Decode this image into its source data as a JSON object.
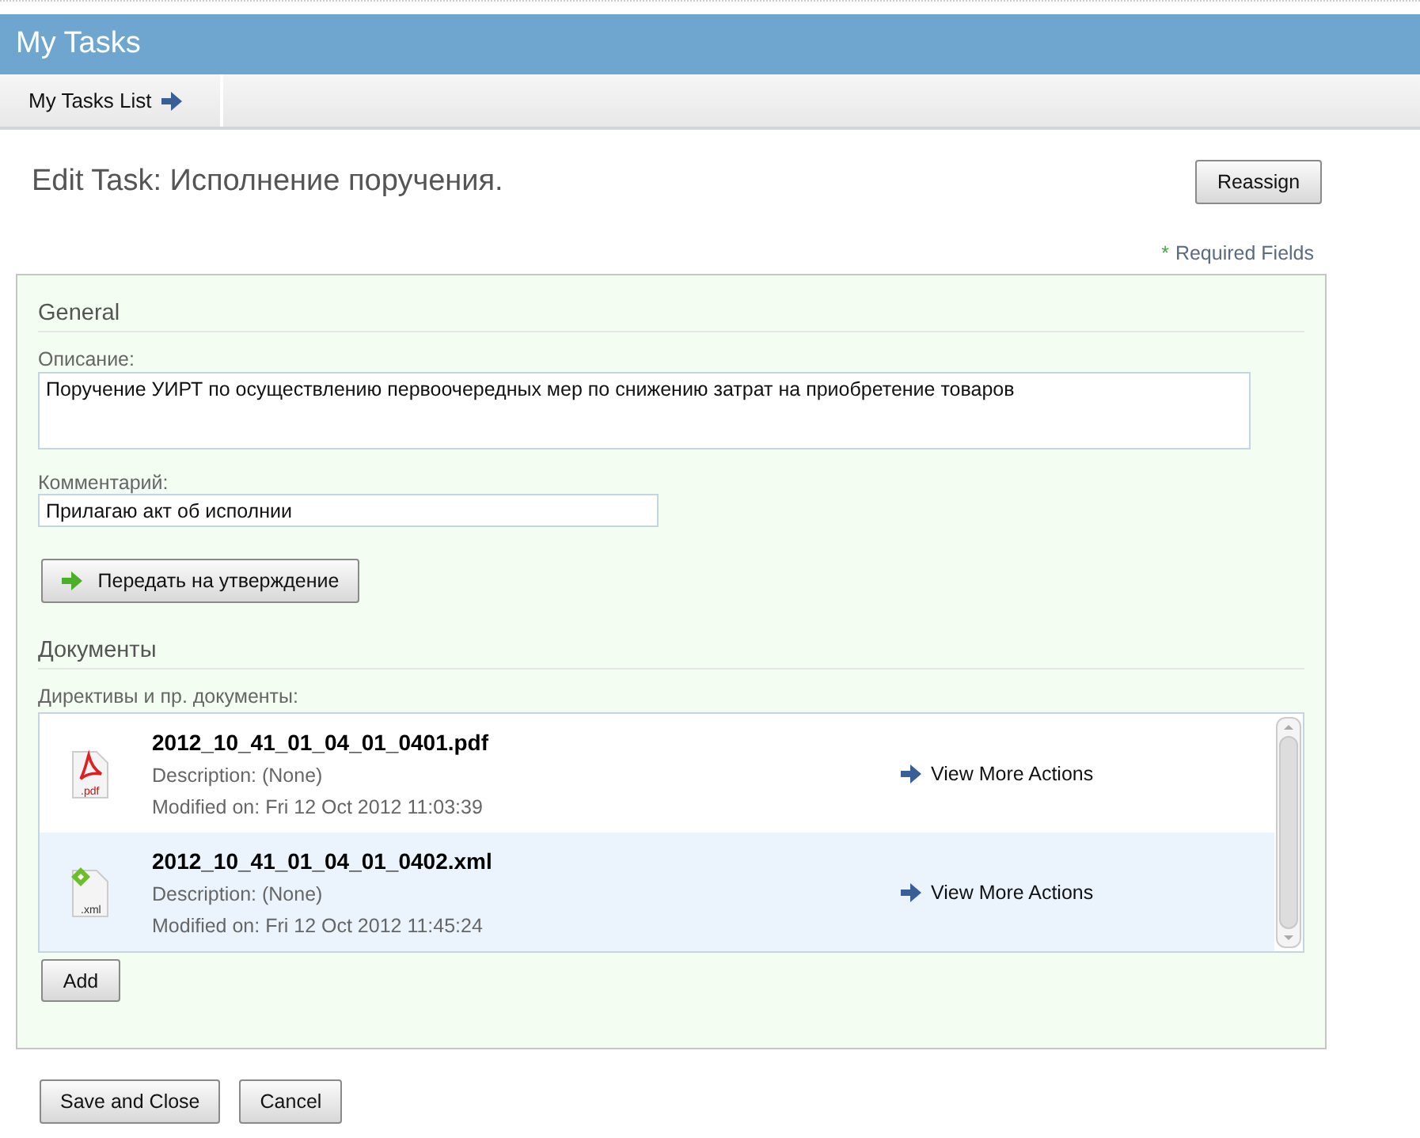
{
  "header": {
    "title": "My Tasks"
  },
  "toolbar": {
    "link": "My Tasks List"
  },
  "page_title": "Edit Task: Исполнение поручения.",
  "reassign_button": "Reassign",
  "required_note": {
    "marker": "*",
    "text": "Required Fields"
  },
  "general": {
    "heading": "General",
    "description_label": "Описание:",
    "description_value": "Поручение УИРТ по осуществлению первоочередных мер по снижению затрат на приобретение товаров",
    "comment_label": "Комментарий:",
    "comment_value": "Прилагаю акт об исполнии",
    "submit_button": "Передать на утверждение"
  },
  "documents": {
    "heading": "Документы",
    "list_label": "Директивы и пр. документы:",
    "items": [
      {
        "kind": "pdf",
        "icon_label": ".pdf",
        "name": "2012_10_41_01_04_01_0401.pdf",
        "description": "Description: (None)",
        "modified": "Modified on: Fri 12 Oct 2012 11:03:39",
        "action": "View More Actions",
        "selected": false
      },
      {
        "kind": "xml",
        "icon_label": ".xml",
        "name": "2012_10_41_01_04_01_0402.xml",
        "description": "Description: (None)",
        "modified": "Modified on: Fri 12 Oct 2012 11:45:24",
        "action": "View More Actions",
        "selected": true
      }
    ],
    "add_button": "Add"
  },
  "footer_buttons": [
    "Save and Close",
    "Cancel"
  ]
}
